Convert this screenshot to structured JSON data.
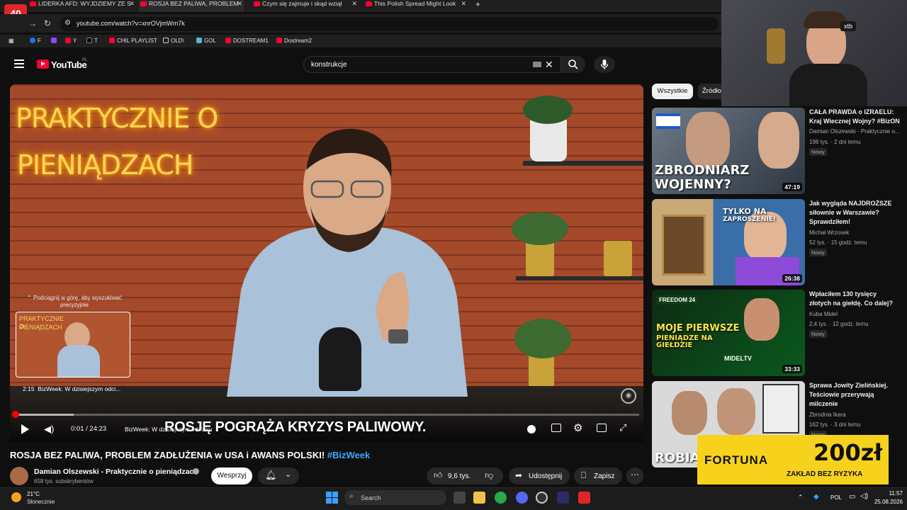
{
  "browser": {
    "tabs": [
      {
        "label": "LIDERKA AFD: WYJDZIEMY ZE S"
      },
      {
        "label": "ROSJA BEZ PALIWA, PROBLEM"
      },
      {
        "label": "Czym się zajmuje i skąd wziął"
      },
      {
        "label": "This Polish Spread Might Look"
      }
    ],
    "url": "youtube.com/watch?v=xnrOVjmWm7k",
    "bookmarks": [
      "F",
      "",
      "Y",
      "T",
      "CHIL PLAYLIST",
      "OLD\\",
      "GOL",
      "DOSTREAM1",
      "Dostream2"
    ]
  },
  "youtube": {
    "logo_text": "YouTube",
    "region": "PL",
    "search_value": "konstrukcje"
  },
  "video": {
    "neon_line1": "PRAKTYCZNIE O",
    "neon_line2": "PIENIĄDZACH",
    "scrub_hint": "Podciągnij w górę, aby wyszukiwać precyzyjnie",
    "preview_time": "2:15",
    "preview_chapter": "BizWeek: W dzisiejszym odci...",
    "time": "0:01 / 24:23",
    "chapter": "BizWeek: W dzisiejszym odcinku",
    "overlay_title": "ROSJĘ POGRĄŻA KRYZYS PALIWOWY.",
    "progress_fraction": 0.0007
  },
  "meta": {
    "title": "ROSJA BEZ PALIWA, PROBLEM ZADŁUŻENIA w USA i AWANS POLSKI!",
    "hashtag": "#BizWeek",
    "channel": "Damian Olszewski - Praktycznie o pieniądzach",
    "subscribers": "658 tys. subskrybentów",
    "support_label": "Wesprzyj",
    "likes": "9,6 tys.",
    "share_label": "Udostępnij",
    "save_label": "Zapisz"
  },
  "chips": [
    "Wszystkie",
    "Źródło"
  ],
  "recommendations": [
    {
      "title": "CAŁA PRAWDA o IZRAELU: Kraj Wiecznej Wojny? #BizON",
      "channel": "Damian Olszewski - Praktycznie o...",
      "views": "198 tys.",
      "age": "2 dni temu",
      "badge": "Nowy",
      "duration": "47:19",
      "thumb_line1": "ZBRODNIARZ",
      "thumb_line2": "WOJENNY?"
    },
    {
      "title": "Jak wygląda NAJDROŻSZE siłownie w Warszawie? Sprawdziłem!",
      "channel": "Michał Wrzosek",
      "views": "52 tys.",
      "age": "15 godz. temu",
      "badge": "Nowy",
      "duration": "26:38",
      "thumb_line1": "TYLKO NA",
      "thumb_line2": "ZAPROSZENIE!"
    },
    {
      "title": "Wpłaciłem 130 tysięcy złotych na giełdę. Co dalej?",
      "channel": "Kuba Midel",
      "views": "2,4 tys.",
      "age": "12 godz. temu",
      "badge": "Nowy",
      "duration": "33:33",
      "thumb_line1": "MOJE PIERWSZE",
      "thumb_line2": "PIENIĄDZE NA GIEŁDZIE",
      "thumb_tag": "FREEDOM 24",
      "thumb_brand": "MIDELTV"
    },
    {
      "title": "Sprawa Jowity Zielińskiej. Teściowie przerywają milczenie",
      "channel": "Zbrodnia Ikara",
      "views": "162 tys.",
      "age": "3 dni temu",
      "badge": "Nowy",
      "duration": "",
      "thumb_line1": "ROBIĄ Z",
      "thumb_line2": ""
    }
  ],
  "webcam": {
    "badge": "xtb"
  },
  "ad": {
    "brand": "FORTUNA",
    "amount": "200zł",
    "line": "ZAKŁAD BEZ RYZYKA"
  },
  "taskbar": {
    "temperature": "21°C",
    "condition": "Słonecznie",
    "search_placeholder": "Search",
    "language": "POL",
    "time": "11:57",
    "date": "25.08.2026"
  },
  "colors": {
    "youtube_red": "#ff0033",
    "link_blue": "#3ea6ff",
    "ad_yellow": "#f7d21c"
  }
}
